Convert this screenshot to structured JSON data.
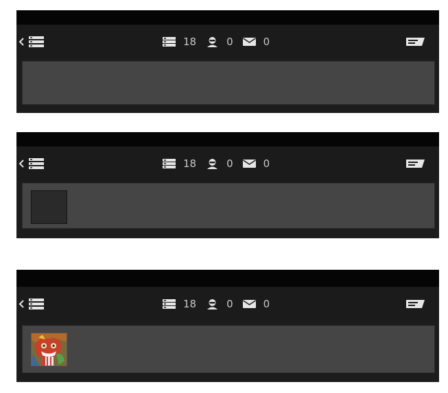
{
  "panels": [
    {
      "stats": {
        "list_count": "18",
        "user_count": "0",
        "message_count": "0"
      },
      "thumbnail": "none"
    },
    {
      "stats": {
        "list_count": "18",
        "user_count": "0",
        "message_count": "0"
      },
      "thumbnail": "placeholder"
    },
    {
      "stats": {
        "list_count": "18",
        "user_count": "0",
        "message_count": "0"
      },
      "thumbnail": "image"
    }
  ],
  "colors": {
    "panel_bg": "#1c1c1c",
    "top_bar": "#050505",
    "content_bg": "#454545",
    "icon": "#e6e6e6",
    "text": "#c9c9c9"
  },
  "icons": [
    "chevron-left-icon",
    "menu-list-icon",
    "user-icon",
    "mail-icon",
    "message-icon"
  ]
}
